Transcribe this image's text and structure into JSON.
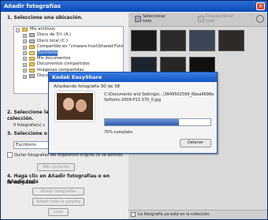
{
  "window": {
    "title": "Añadir fotografías",
    "close_glyph": "✕"
  },
  "steps": {
    "step1": "1.  Seleccione una ubicación.",
    "step2": "2.  Seleccione las fo",
    "step2b": "colección.",
    "step2_count": "0 fotografía(s) s",
    "step3": "3.  Seleccione o esc",
    "step4": "4.  Haga clic en Añadir fotografías o en Añadir toda",
    "step4b": "la carpeta."
  },
  "tree": {
    "items": [
      {
        "label": "Mis archivos",
        "indent": 0,
        "icon": "folder-icon",
        "highlight": false
      },
      {
        "label": "Disco de 3½ (A:)",
        "indent": 1,
        "icon": "drive-icon",
        "highlight": false
      },
      {
        "label": "Disco local (C:)",
        "indent": 1,
        "icon": "drive-icon",
        "highlight": false
      },
      {
        "label": "Compartido en \"vmware-host\\Shared Folders",
        "indent": 1,
        "icon": "network-icon",
        "highlight": false
      },
      {
        "label": "Escritorio",
        "indent": 1,
        "icon": "folder-icon",
        "highlight": true
      },
      {
        "label": "Mis documentos",
        "indent": 1,
        "icon": "folder-icon",
        "highlight": false
      },
      {
        "label": "Documentos compartidos",
        "indent": 1,
        "icon": "folder-icon",
        "highlight": false
      },
      {
        "label": "Imágenes compartidas",
        "indent": 1,
        "icon": "folder-icon",
        "highlight": false
      },
      {
        "label": "Disco loc",
        "indent": 1,
        "icon": "drive-icon",
        "highlight": false
      }
    ]
  },
  "collection_input": {
    "value": "Escritorio"
  },
  "checkbox": {
    "label": "Quitar fotografías del dispositivo original (si se admite)",
    "checked": false
  },
  "buttons": {
    "more_options": "Más opciones",
    "add_photos": "Añadir fotografías",
    "add_folder": "Añadir toda la carpeta",
    "help": "Listo"
  },
  "toolbar": {
    "select_all": "Seleccionar\ntodo",
    "deselect_all": "Deseleccionar\ntodo"
  },
  "footer": {
    "status": "La fotografía ya está en la colección"
  },
  "dialog": {
    "title": "Kodak EasyShare",
    "status": "Añadiendo fotografía 30 de 38",
    "path1": "C:\\Documents and Settings\\...\\3649502599_6bea9698a",
    "path2": "Softonic-2009-P13 370_0.jpg",
    "percent_text": "70% completo",
    "progress": 0.7,
    "cancel_label": "Detener"
  }
}
